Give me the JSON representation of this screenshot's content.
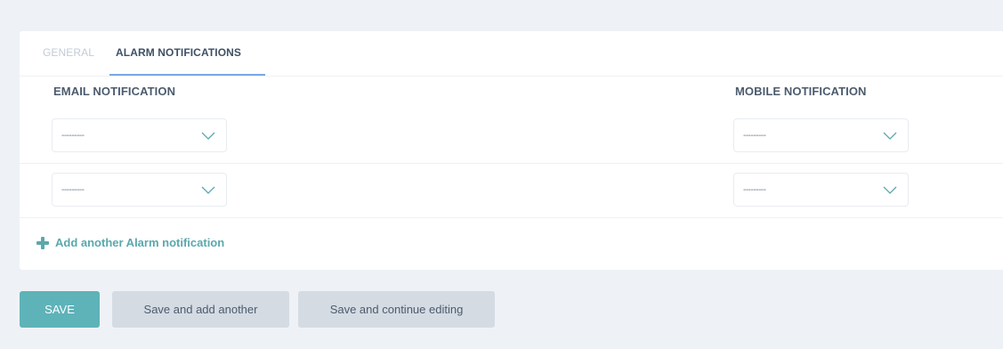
{
  "tabs": [
    {
      "label": "GENERAL",
      "active": false
    },
    {
      "label": "ALARM NOTIFICATIONS",
      "active": true
    }
  ],
  "columns": {
    "email": "EMAIL NOTIFICATION",
    "mobile": "MOBILE NOTIFICATION"
  },
  "rows": [
    {
      "email_value": "---------",
      "mobile_value": "---------"
    },
    {
      "email_value": "---------",
      "mobile_value": "---------"
    }
  ],
  "add_link": "Add another Alarm notification",
  "buttons": {
    "save": "SAVE",
    "save_add_another": "Save and add another",
    "save_continue": "Save and continue editing"
  },
  "colors": {
    "accent": "#5eb3b8",
    "tab_underline": "#79a9e6",
    "background": "#eef2f6"
  },
  "icons": {
    "select_chevron": "chevron-down-icon",
    "add": "plus-icon"
  }
}
